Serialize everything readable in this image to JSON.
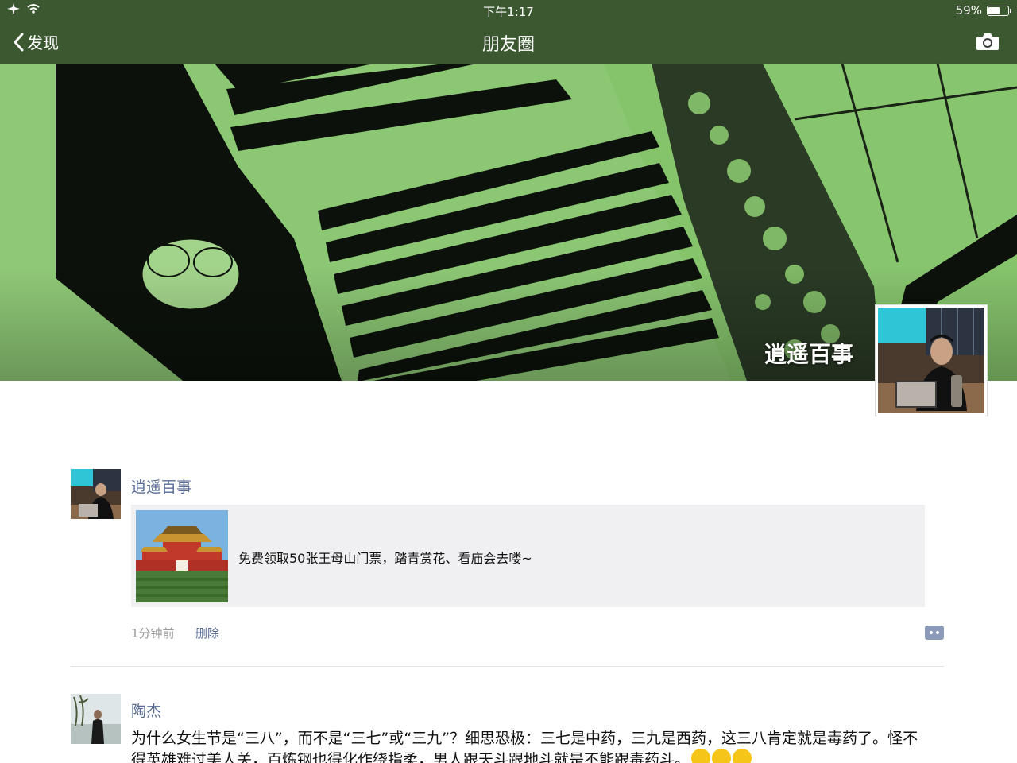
{
  "status_bar": {
    "time": "下午1:17",
    "battery_text": "59%",
    "battery_level": 0.59,
    "left_icons": [
      "airplane-icon",
      "wifi-icon"
    ]
  },
  "nav_bar": {
    "back_label": "发现",
    "title": "朋友圈",
    "right_icon": "camera-icon"
  },
  "profile": {
    "name": "逍遥百事"
  },
  "posts": [
    {
      "author": "逍遥百事",
      "share_text": "免费领取50张王母山门票，踏青赏花、看庙会去喽~",
      "time": "1分钟前",
      "delete_label": "删除"
    },
    {
      "author": "陶杰",
      "text": "为什么女生节是“三八”，而不是“三七”或“三九”？细思恐极：三七是中药，三九是西药，这三八肯定就是毒药了。怪不得英雄难过美人关，百炼钢也得化作绕指柔，男人跟天斗跟地斗就是不能跟毒药斗。",
      "emoji_count": 3
    }
  ],
  "colors": {
    "link_blue": "#576b95",
    "cover_green": "#86c46c",
    "card_bg": "#f0f0f2"
  }
}
